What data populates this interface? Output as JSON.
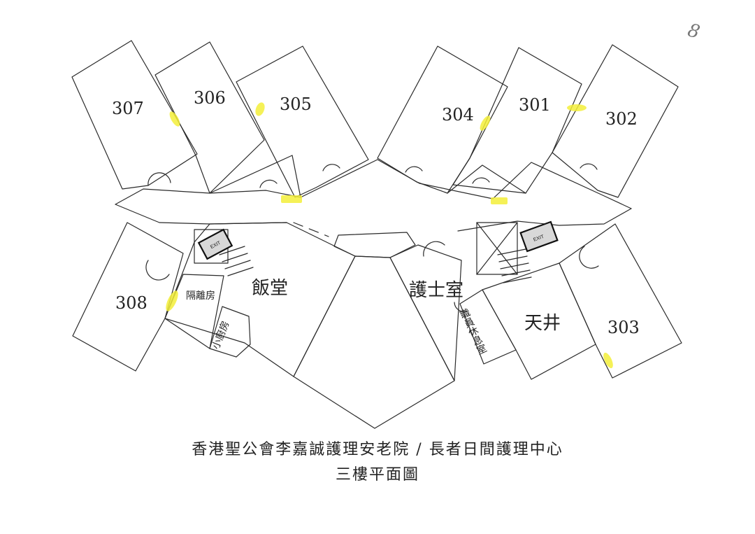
{
  "page_mark": "8",
  "rooms": {
    "r307": "307",
    "r306": "306",
    "r305": "305",
    "r304": "304",
    "r301": "301",
    "r302": "302",
    "r308": "308",
    "r303": "303"
  },
  "areas": {
    "isolation": "隔離房",
    "dining": "飯堂",
    "pantry": "小廚房",
    "nurse_station": "護士室",
    "staff_rest": "職員休息室",
    "courtyard": "天井"
  },
  "exit_sign": "EXIT",
  "caption": {
    "line1": "香港聖公會李嘉誠護理安老院 /  長者日間護理中心",
    "line2": "三樓平面圖"
  },
  "colors": {
    "highlight": "#f3ef3a",
    "line": "#2a2a2a"
  }
}
